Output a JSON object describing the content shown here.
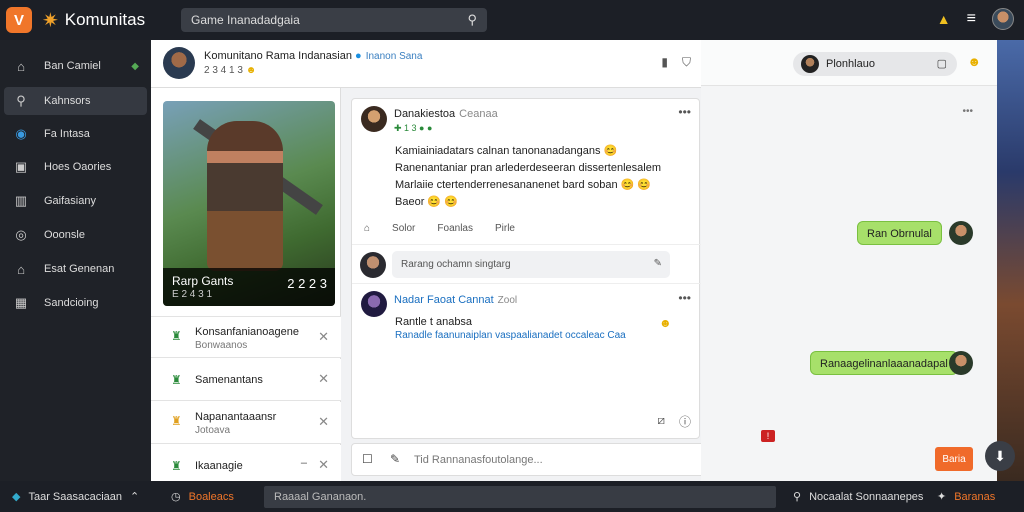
{
  "topbar": {
    "brand": "Komunitas",
    "search_value": "Game Inanadadgaia",
    "logo_glyph": "V",
    "brand_glyph": "✷"
  },
  "sidebar": {
    "items": [
      {
        "label": "Ban Camiel",
        "icon": "home-icon",
        "glyph": "⌂"
      },
      {
        "label": "Kahnsors",
        "icon": "search-icon",
        "glyph": "⚲"
      },
      {
        "label": "Fa Intasa",
        "icon": "circle-icon",
        "glyph": "◉"
      },
      {
        "label": "Hoes Oaories",
        "icon": "image-icon",
        "glyph": "▣"
      },
      {
        "label": "Gaifasiany",
        "icon": "chart-icon",
        "glyph": "▥"
      },
      {
        "label": "Ooonsle",
        "icon": "chat-icon",
        "glyph": "◎"
      },
      {
        "label": "Esat Genenan",
        "icon": "building-icon",
        "glyph": "⌂"
      },
      {
        "label": "Sandcioing",
        "icon": "grid-icon",
        "glyph": "▦"
      }
    ]
  },
  "group": {
    "title": "Komunitano Rama Indanasian",
    "subtitle": "Inanon Sana",
    "meta": "2 3 4 1 3"
  },
  "hero": {
    "name": "Rarp Gants",
    "sub": "E 2 4 3 1",
    "count": "2 2 2 3"
  },
  "groups_list": [
    {
      "title": "Konsanfanianoagene",
      "sub": "Bonwaanos"
    },
    {
      "title": "Samenantans",
      "sub": ""
    },
    {
      "title": "Napanantaaansr",
      "sub": "Jotoava"
    },
    {
      "title": "Ikaanagie",
      "sub": ""
    }
  ],
  "post1": {
    "author": "Danakiestoa",
    "group": "Ceanaa",
    "meta": "✚ 1 3 ● ●",
    "lines": [
      "Kamiainiadatars calnan tanonanadangans 😊",
      "Ranenantaniar pran arlederdeseeran dissertenlesalem",
      "Marlaiie ctertenderrenesananenet bard soban 😊 😊",
      "Baeor 😊 😊"
    ],
    "actions": [
      "Solor",
      "Foanlas",
      "Pirle"
    ]
  },
  "comment_placeholder": "Rarang ochamn singtarg",
  "post2": {
    "author": "Nadar Faoat Cannat",
    "time": "Zool",
    "line1": "Rantle t anabsa",
    "line2": "Ranadle faanunaiplan vaspaalianadet occaleac Caa"
  },
  "compose_placeholder": "Tid Rannanasfoutolange...",
  "send_label": "Baria",
  "chat": {
    "contact": "Plonhlauo",
    "bubbles": [
      "Ran Obrnulal",
      "Ranaagelinanlaaanadapal"
    ]
  },
  "bottombar": {
    "left": "Taar Saasacaciaan",
    "second": "Boaleacs",
    "input": "Raaaal Gananaon.",
    "right": "Nocaalat Sonnaanepes",
    "right2": "Baranas"
  }
}
